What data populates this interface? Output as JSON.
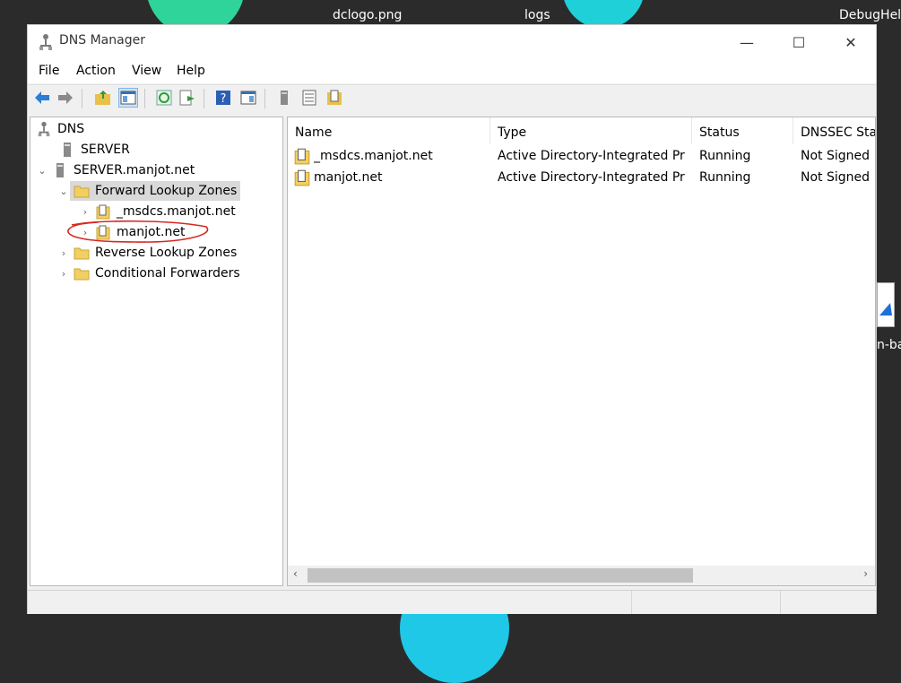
{
  "desktop": {
    "labels": [
      "dclogo.png",
      "logs",
      "DebugHel",
      "n-ba"
    ]
  },
  "window": {
    "title": "DNS Manager",
    "minimize": "—",
    "maximize": "☐",
    "close": "✕"
  },
  "menu": [
    "File",
    "Action",
    "View",
    "Help"
  ],
  "tree": {
    "root": "DNS",
    "server1": "SERVER",
    "server2": "SERVER.manjot.net",
    "forward": "Forward Lookup Zones",
    "zone1": "_msdcs.manjot.net",
    "zone2": "manjot.net",
    "reverse": "Reverse Lookup Zones",
    "conditional": "Conditional Forwarders"
  },
  "list": {
    "columns": [
      "Name",
      "Type",
      "Status",
      "DNSSEC Statu"
    ],
    "rows": [
      {
        "name": "_msdcs.manjot.net",
        "type": "Active Directory-Integrated Pri...",
        "status": "Running",
        "dnssec": "Not Signed"
      },
      {
        "name": "manjot.net",
        "type": "Active Directory-Integrated Pri...",
        "status": "Running",
        "dnssec": "Not Signed"
      }
    ]
  },
  "colors": {
    "annotation": "#d6281f",
    "blob": "#1fd0d8",
    "blob_green": "#2fd49a"
  }
}
